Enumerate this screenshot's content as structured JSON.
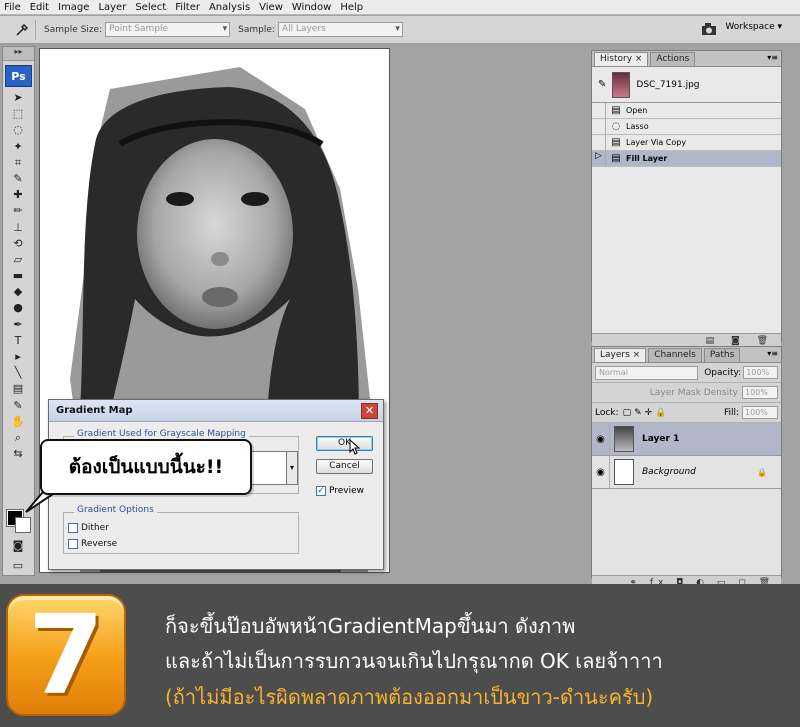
{
  "menu": [
    "File",
    "Edit",
    "Image",
    "Layer",
    "Select",
    "Filter",
    "Analysis",
    "View",
    "Window",
    "Help"
  ],
  "options": {
    "sample_size_label": "Sample Size:",
    "sample_size_value": "Point Sample",
    "sample_label": "Sample:",
    "sample_value": "All Layers",
    "workspace": "Workspace ▾"
  },
  "toolbox": {
    "logo": "Ps",
    "grip": "▸▸"
  },
  "dialog": {
    "title": "Gradient Map",
    "close": "✕",
    "group1_legend": "Gradient Used for Grayscale Mapping",
    "group2_legend": "Gradient Options",
    "dither": "Dither",
    "reverse": "Reverse",
    "ok": "OK",
    "cancel": "Cancel",
    "preview": "Preview",
    "dropdown": "▾",
    "check": "✓"
  },
  "bubble": "ต้องเป็นแบบนี้นะ!!",
  "history": {
    "tabs": [
      "History ×",
      "Actions"
    ],
    "menu": "▾≡",
    "snapshot": "DSC_7191.jpg",
    "steps": [
      "Open",
      "Lasso",
      "Layer Via Copy",
      "Fill Layer"
    ],
    "footer": "▤ ◙ 🗑"
  },
  "layers": {
    "tabs": [
      "Layers ×",
      "Channels",
      "Paths"
    ],
    "menu": "▾≡",
    "mode": "Normal",
    "opacity_label": "Opacity:",
    "opacity_value": "100%",
    "mask_density_label": "Layer Mask Density",
    "mask_density_value": "100%",
    "lock_label": "Lock:",
    "fill_label": "Fill:",
    "fill_value": "100%",
    "items": [
      {
        "name": "Layer 1",
        "selected": true
      },
      {
        "name": "Background",
        "selected": false
      }
    ],
    "lock_icon": "🔒",
    "footer": "⚭ fx ◘ ◐ ▭ ◻ 🗑"
  },
  "banner": {
    "number": "7",
    "line1": "ก็จะขึ้นป๊อบอัพหน้าGradientMapขึ้นมา ดังภาพ",
    "line2": "และถ้าไม่เป็นการรบกวนจนเกินไปกรุณากด OK เลยจ้าาาา",
    "line3": "(ถ้าไม่มีอะไรผิดพลาดภาพต้องออกมาเป็นขาว-ดำนะครับ)"
  }
}
